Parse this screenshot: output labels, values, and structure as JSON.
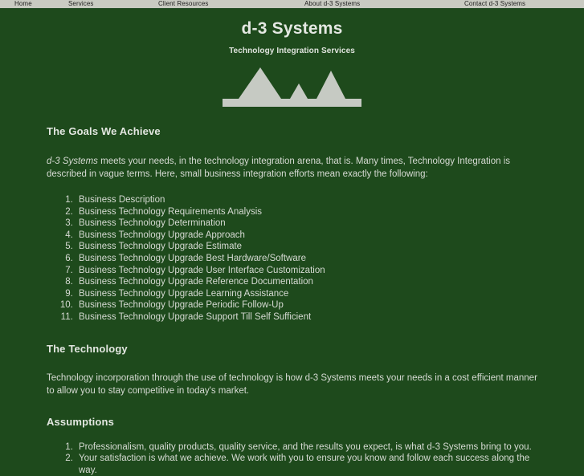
{
  "theme": {
    "page_background": "#1e4a1c",
    "nav_background": "#c9cbc2",
    "text_color": "#d6dad3",
    "logo_color": "#c6cac3"
  },
  "nav": {
    "items": [
      {
        "label": "Home"
      },
      {
        "label": "Services"
      },
      {
        "label": "Client Resources"
      },
      {
        "label": "About d-3 Systems"
      },
      {
        "label": "Contact d-3 Systems"
      }
    ]
  },
  "masthead": {
    "title": "d-3 Systems",
    "tagline": "Technology Integration Services",
    "logo_icon": "mountain-peaks-logo"
  },
  "main": {
    "goals": {
      "heading": "The Goals We Achieve",
      "intro_lead": "d-3 Systems",
      "intro_rest": " meets your needs, in the technology integration arena, that is. Many times, Technology Integration is described in vague terms. Here, small business integration efforts mean exactly the following:",
      "items": [
        "Business Description",
        "Business Technology Requirements Analysis",
        "Business Technology Determination",
        "Business Technology Upgrade Approach",
        "Business Technology Upgrade Estimate",
        "Business Technology Upgrade Best Hardware/Software",
        "Business Technology Upgrade User Interface Customization",
        "Business Technology Upgrade Reference Documentation",
        "Business Technology Upgrade Learning Assistance",
        "Business Technology Upgrade Periodic Follow-Up",
        "Business Technology Upgrade Support Till Self Sufficient"
      ]
    },
    "technology": {
      "heading": "The Technology",
      "paragraph": "Technology incorporation through the use of technology is how d-3 Systems meets your needs in a cost efficient manner to allow you to stay competitive in today's market."
    },
    "assumptions": {
      "heading": "Assumptions",
      "items": [
        "Professionalism, quality products, quality service, and the results you expect, is what d-3 Systems bring to you.",
        "Your satisfaction is what we achieve. We work with you to ensure you know and follow each success along the way."
      ]
    }
  }
}
